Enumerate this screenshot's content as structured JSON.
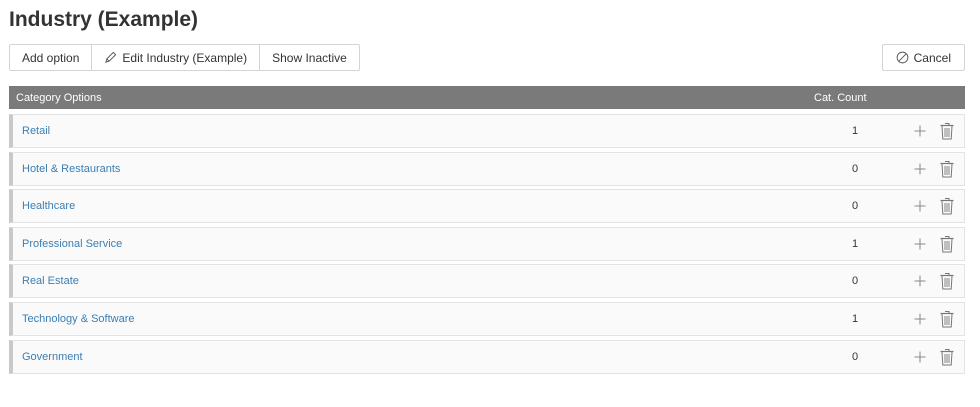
{
  "page": {
    "title": "Industry (Example)"
  },
  "toolbar": {
    "add_option": "Add option",
    "edit": "Edit Industry (Example)",
    "show_inactive": "Show Inactive",
    "cancel": "Cancel"
  },
  "table": {
    "headers": {
      "category": "Category Options",
      "count": "Cat. Count"
    },
    "rows": [
      {
        "label": "Retail",
        "count": "1"
      },
      {
        "label": "Hotel & Restaurants",
        "count": "0"
      },
      {
        "label": "Healthcare",
        "count": "0"
      },
      {
        "label": "Professional Service",
        "count": "1"
      },
      {
        "label": "Real Estate",
        "count": "0"
      },
      {
        "label": "Technology & Software",
        "count": "1"
      },
      {
        "label": "Government",
        "count": "0"
      }
    ]
  },
  "icons": {
    "edit": "pencil-icon",
    "cancel": "cancel-icon",
    "add": "plus-icon",
    "delete": "trash-icon"
  },
  "colors": {
    "header_bg": "#7a7a7a",
    "link": "#3a7fb5",
    "row_bg": "#fafafa",
    "row_accent": "#c9c9c9"
  }
}
